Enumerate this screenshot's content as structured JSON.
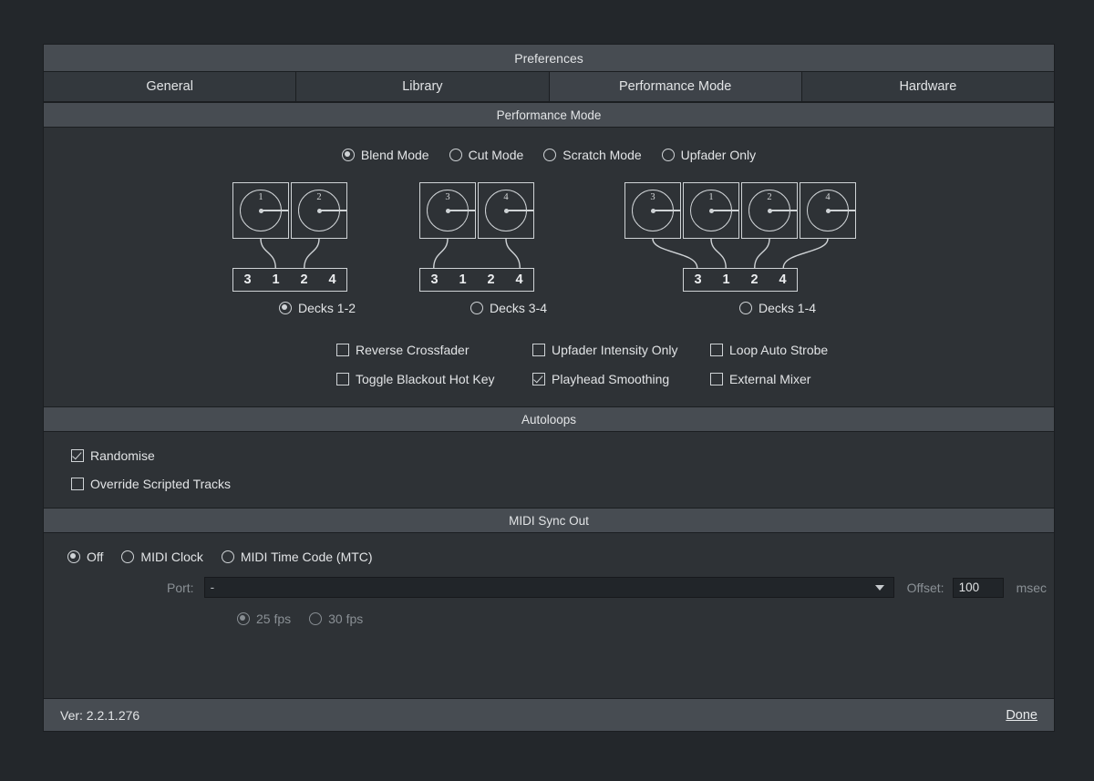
{
  "window": {
    "title": "Preferences"
  },
  "tabs": [
    {
      "label": "General",
      "active": false
    },
    {
      "label": "Library",
      "active": false
    },
    {
      "label": "Performance Mode",
      "active": true
    },
    {
      "label": "Hardware",
      "active": false
    }
  ],
  "performance_mode": {
    "section_title": "Performance Mode",
    "modes": [
      {
        "label": "Blend Mode",
        "selected": true
      },
      {
        "label": "Cut Mode",
        "selected": false
      },
      {
        "label": "Scratch Mode",
        "selected": false
      },
      {
        "label": "Upfader Only",
        "selected": false
      }
    ],
    "diagrams": [
      {
        "decks": [
          "1",
          "2"
        ],
        "mixer_channels": [
          "3",
          "1",
          "2",
          "4"
        ],
        "connect_to": [
          1,
          2
        ]
      },
      {
        "decks": [
          "3",
          "4"
        ],
        "mixer_channels": [
          "3",
          "1",
          "2",
          "4"
        ],
        "connect_to": [
          0,
          3
        ]
      },
      {
        "decks": [
          "3",
          "1",
          "2",
          "4"
        ],
        "mixer_channels": [
          "3",
          "1",
          "2",
          "4"
        ],
        "connect_to": [
          0,
          1,
          2,
          3
        ]
      }
    ],
    "deck_options": [
      {
        "label": "Decks 1-2",
        "selected": true
      },
      {
        "label": "Decks 3-4",
        "selected": false
      },
      {
        "label": "Decks 1-4",
        "selected": false
      }
    ],
    "checkboxes": [
      {
        "label": "Reverse Crossfader",
        "checked": false
      },
      {
        "label": "Upfader Intensity Only",
        "checked": false
      },
      {
        "label": "Loop Auto Strobe",
        "checked": false
      },
      {
        "label": "Toggle Blackout Hot Key",
        "checked": false
      },
      {
        "label": "Playhead Smoothing",
        "checked": true
      },
      {
        "label": "External Mixer",
        "checked": false
      }
    ]
  },
  "autoloops": {
    "section_title": "Autoloops",
    "checkboxes": [
      {
        "label": "Randomise",
        "checked": true
      },
      {
        "label": "Override Scripted Tracks",
        "checked": false
      }
    ]
  },
  "midi_sync_out": {
    "section_title": "MIDI Sync Out",
    "modes": [
      {
        "label": "Off",
        "selected": true
      },
      {
        "label": "MIDI Clock",
        "selected": false
      },
      {
        "label": "MIDI Time Code (MTC)",
        "selected": false
      }
    ],
    "port_label": "Port:",
    "port_value": "-",
    "offset_label": "Offset:",
    "offset_value": "100",
    "offset_unit": "msec",
    "fps_options": [
      {
        "label": "25 fps",
        "selected": true
      },
      {
        "label": "30 fps",
        "selected": false
      }
    ]
  },
  "footer": {
    "version": "Ver: 2.2.1.276",
    "done_label": "Done"
  }
}
